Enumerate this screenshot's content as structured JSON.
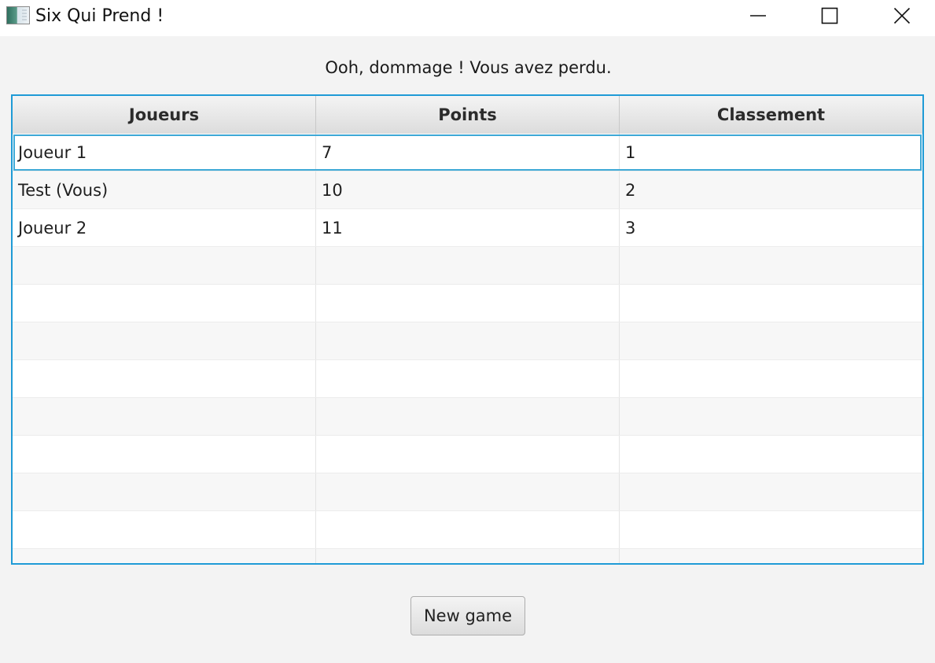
{
  "window": {
    "title": "Six Qui Prend !",
    "icon": "app-icon",
    "controls": {
      "minimize_icon": "minimize-icon",
      "maximize_icon": "maximize-icon",
      "close_icon": "close-icon"
    }
  },
  "message": "Ooh, dommage ! Vous avez perdu.",
  "table": {
    "columns": [
      "Joueurs",
      "Points",
      "Classement"
    ],
    "rows": [
      [
        "Joueur 1",
        "7",
        "1"
      ],
      [
        "Test (Vous)",
        "10",
        "2"
      ],
      [
        "Joueur 2",
        "11",
        "3"
      ]
    ],
    "selected_row": 0
  },
  "buttons": {
    "new_game": "New game"
  },
  "colors": {
    "accent": "#1f9bd6",
    "background": "#f3f3f3",
    "header_top": "#f4f4f4",
    "header_bottom": "#dcdcdc"
  }
}
